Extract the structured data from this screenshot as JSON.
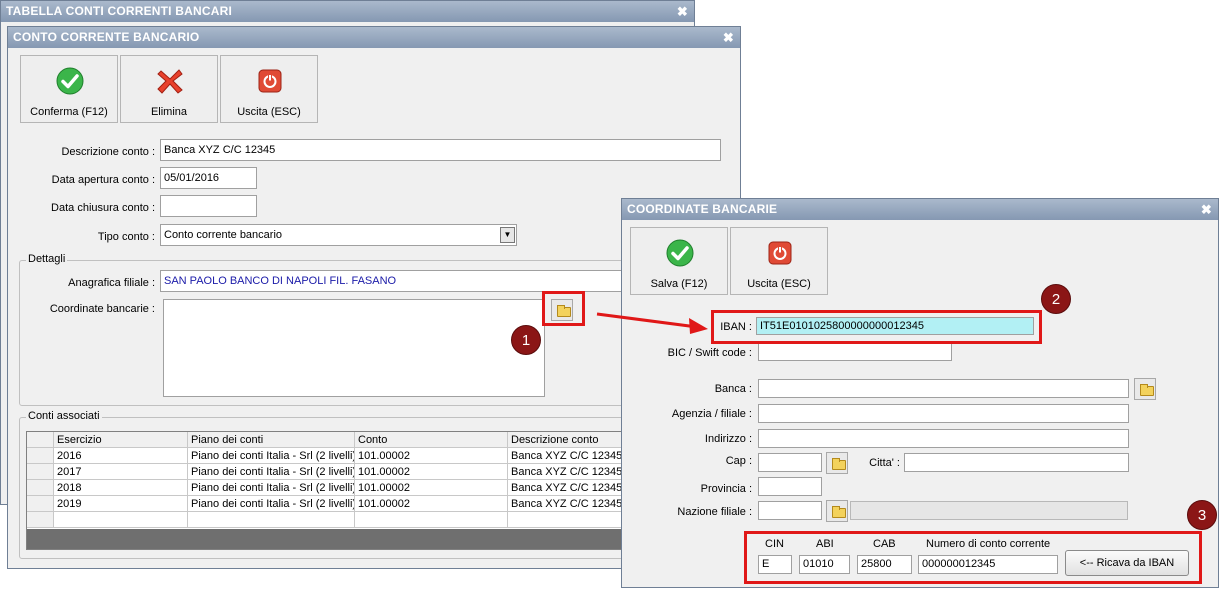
{
  "win_tabella": {
    "title": "TABELLA CONTI CORRENTI BANCARI",
    "close": "✖"
  },
  "win_conto": {
    "title": "CONTO CORRENTE BANCARIO",
    "close": "✖",
    "toolbar": {
      "confirm": "Conferma (F12)",
      "delete": "Elimina",
      "exit": "Uscita (ESC)"
    },
    "labels": {
      "descrizione": "Descrizione conto :",
      "data_apertura": "Data apertura conto :",
      "data_chiusura": "Data chiusura conto :",
      "tipo": "Tipo conto :",
      "dettagli": "Dettagli",
      "anagrafica": "Anagrafica filiale :",
      "coordinate": "Coordinate bancarie :",
      "conti_associati": "Conti associati"
    },
    "values": {
      "descrizione": "Banca XYZ C/C 12345",
      "data_apertura": "05/01/2016",
      "data_chiusura": "",
      "tipo": "Conto corrente bancario",
      "anagrafica": "SAN PAOLO BANCO DI NAPOLI FIL. FASANO",
      "coordinate": ""
    },
    "grid": {
      "headers": [
        "Esercizio",
        "Piano dei conti",
        "Conto",
        "Descrizione conto"
      ],
      "rows": [
        [
          "2016",
          "Piano dei conti Italia - Srl (2 livelli)",
          "101.00002",
          "Banca XYZ C/C 12345"
        ],
        [
          "2017",
          "Piano dei conti Italia - Srl (2 livelli)",
          "101.00002",
          "Banca XYZ C/C 12345"
        ],
        [
          "2018",
          "Piano dei conti Italia - Srl (2 livelli)",
          "101.00002",
          "Banca XYZ C/C 12345"
        ],
        [
          "2019",
          "Piano dei conti Italia - Srl (2 livelli)",
          "101.00002",
          "Banca XYZ C/C 12345"
        ]
      ]
    }
  },
  "win_coord": {
    "title": "COORDINATE BANCARIE",
    "close": "✖",
    "toolbar": {
      "save": "Salva (F12)",
      "exit": "Uscita (ESC)"
    },
    "labels": {
      "iban": "IBAN :",
      "bic": "BIC / Swift code :",
      "banca": "Banca :",
      "agenzia": "Agenzia / filiale :",
      "indirizzo": "Indirizzo :",
      "cap": "Cap :",
      "citta": "Citta' :",
      "provincia": "Provincia :",
      "nazione": "Nazione filiale :",
      "cin": "CIN",
      "abi": "ABI",
      "cab": "CAB",
      "numero": "Numero di conto corrente"
    },
    "values": {
      "iban": "IT51E0101025800000000012345",
      "bic": "",
      "banca": "",
      "agenzia": "",
      "indirizzo": "",
      "cap": "",
      "citta": "",
      "provincia": "",
      "nazione": "",
      "nazione_desc": "",
      "cin": "E",
      "abi": "01010",
      "cab": "25800",
      "numero": "000000012345"
    },
    "ricava_button": "<-- Ricava da IBAN"
  },
  "callouts": [
    "1",
    "2",
    "3"
  ],
  "colors": {
    "title_bar": "#8ea0b8",
    "highlight": "#e01818",
    "badge": "#8b1616",
    "iban_bg": "#b2f0f4",
    "link_text": "#1a1aa8"
  }
}
